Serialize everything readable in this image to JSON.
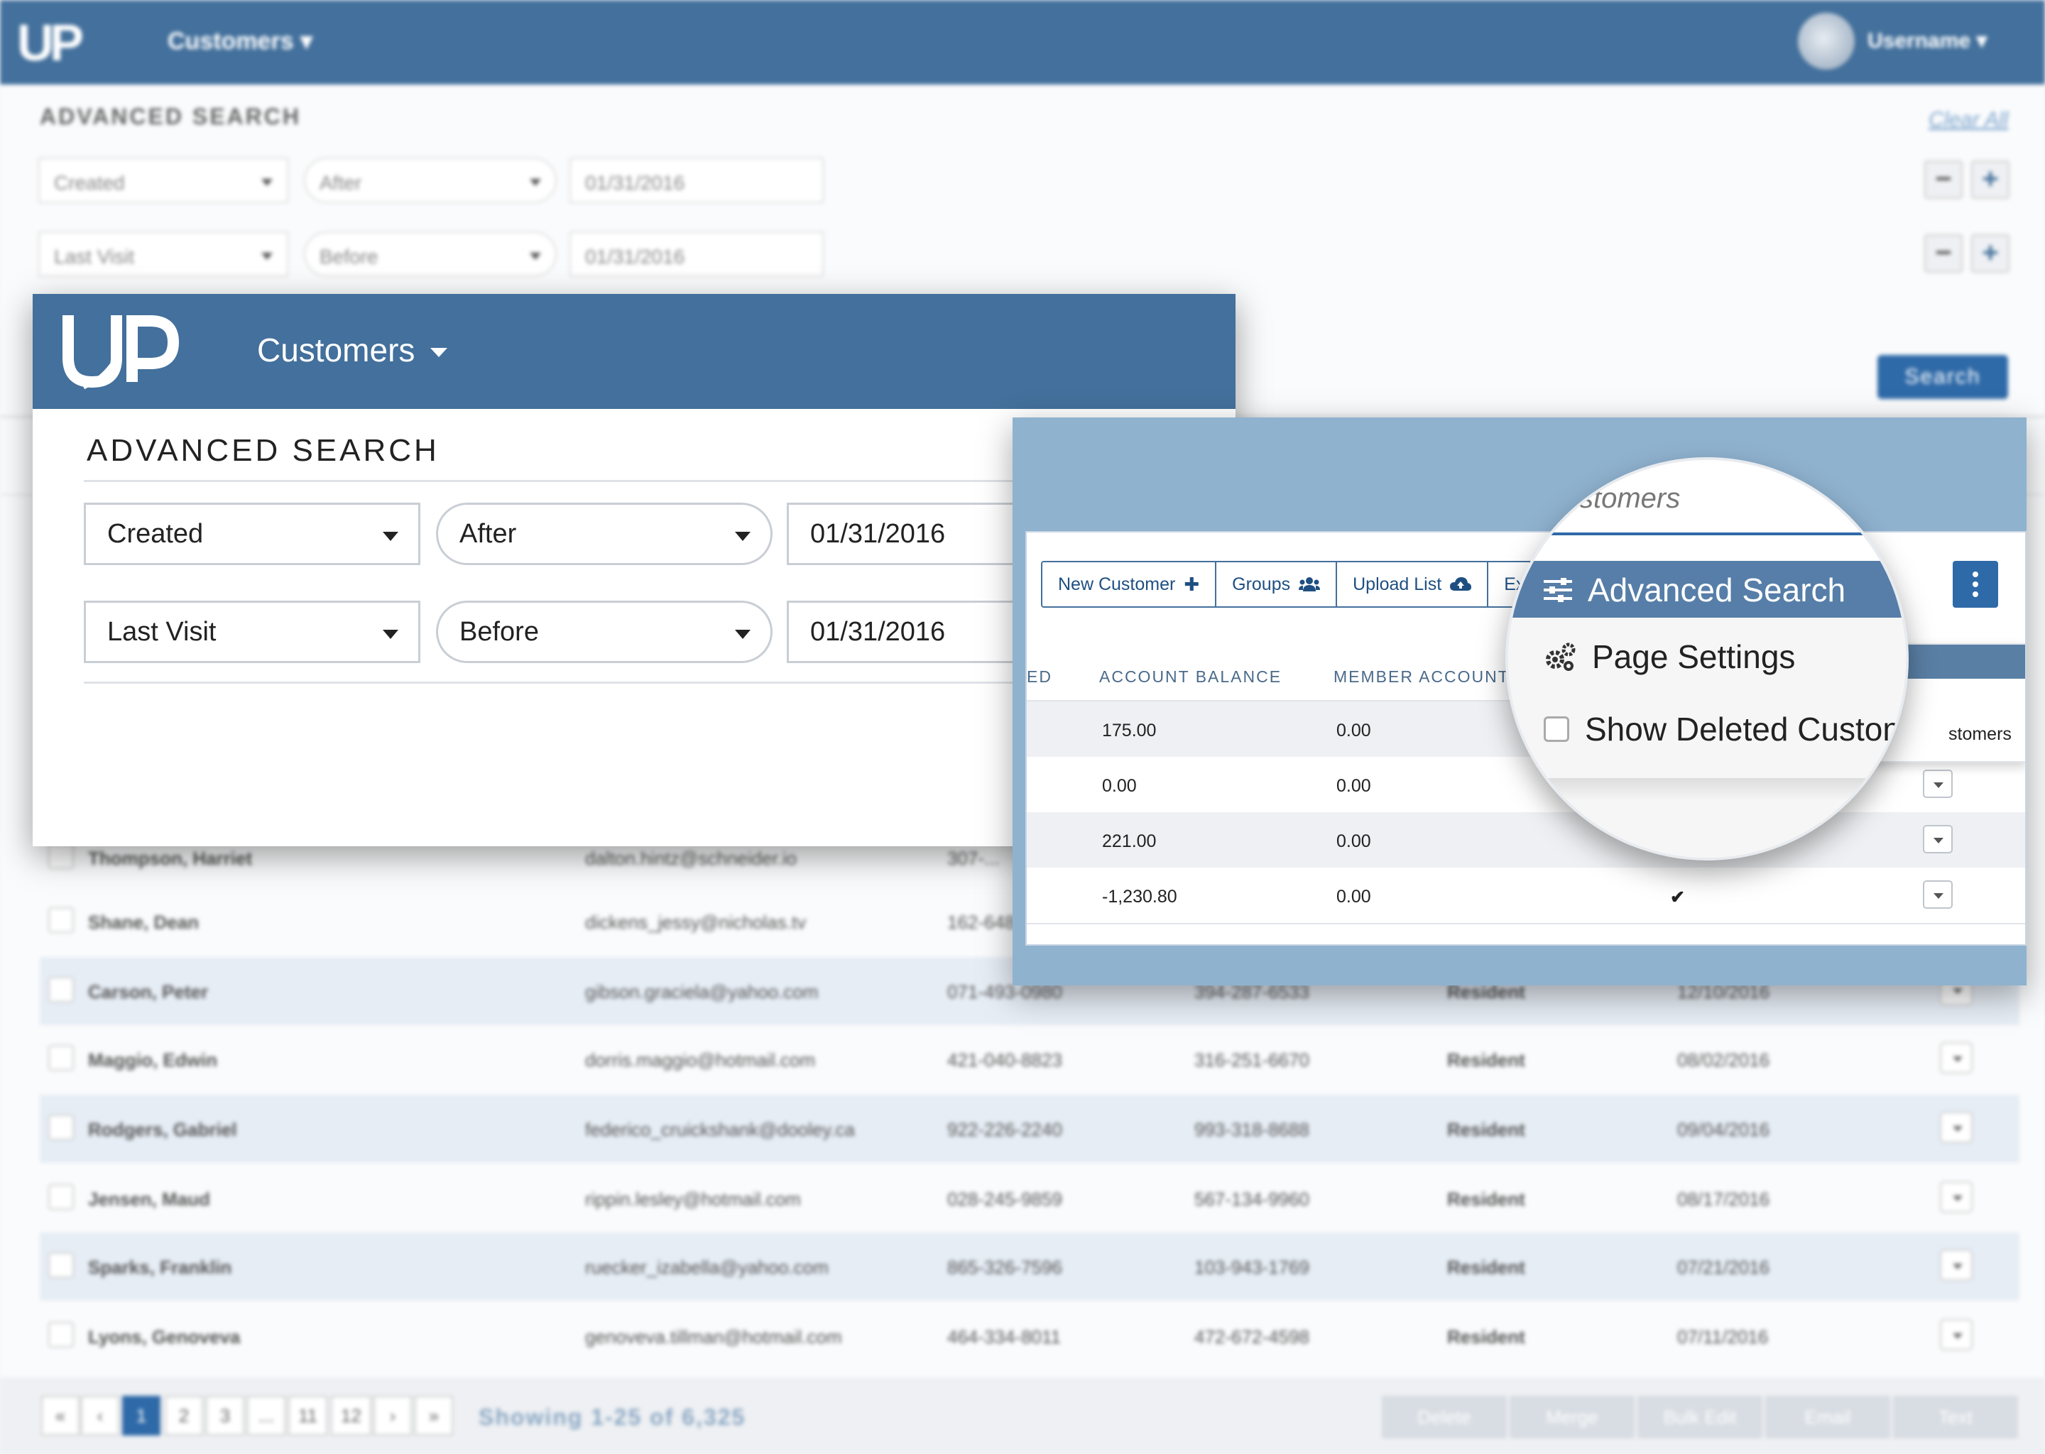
{
  "app": {
    "logo": "UP",
    "nav_label": "Customers",
    "username": "Username"
  },
  "colors": {
    "header": "#43709c",
    "primary": "#2f6aa8",
    "accent_bg": "#8fb2cf",
    "success": "#2e9e3e"
  },
  "advanced_search": {
    "title": "ADVANCED SEARCH",
    "clear_all": "Clear All",
    "search_label": "Search",
    "rows": [
      {
        "field": "Created",
        "operator": "After",
        "value": "01/31/2016"
      },
      {
        "field": "Last Visit",
        "operator": "Before",
        "value": "01/31/2016"
      }
    ]
  },
  "bg_table": {
    "rows": [
      {
        "name": "Thompson, Harriet",
        "email": "dalton.hintz@schneider.io",
        "phone1": "307-...",
        "phone2": "",
        "type": "",
        "date": ""
      },
      {
        "name": "Shane, Dean",
        "email": "dickens_jessy@nicholas.tv",
        "phone1": "162-648-...",
        "phone2": "",
        "type": "",
        "date": ""
      },
      {
        "name": "Carson, Peter",
        "email": "gibson.graciela@yahoo.com",
        "phone1": "071-493-0980",
        "phone2": "394-287-6533",
        "type": "Resident",
        "date": "12/10/2016"
      },
      {
        "name": "Maggio, Edwin",
        "email": "dorris.maggio@hotmail.com",
        "phone1": "421-040-8823",
        "phone2": "316-251-6670",
        "type": "Resident",
        "date": "08/02/2016"
      },
      {
        "name": "Rodgers, Gabriel",
        "email": "federico_cruickshank@dooley.ca",
        "phone1": "922-226-2240",
        "phone2": "993-318-8688",
        "type": "Resident",
        "date": "09/04/2016"
      },
      {
        "name": "Jensen, Maud",
        "email": "rippin.lesley@hotmail.com",
        "phone1": "028-245-9859",
        "phone2": "567-134-9960",
        "type": "Resident",
        "date": "08/17/2016"
      },
      {
        "name": "Sparks, Franklin",
        "email": "ruecker_izabella@yahoo.com",
        "phone1": "865-326-7596",
        "phone2": "103-943-1769",
        "type": "Resident",
        "date": "07/21/2016"
      },
      {
        "name": "Lyons, Genoveva",
        "email": "genoveva.tillman@hotmail.com",
        "phone1": "464-334-8011",
        "phone2": "472-672-4598",
        "type": "Resident",
        "date": "07/11/2016"
      }
    ]
  },
  "pagination": {
    "first": "«",
    "prev": "‹",
    "pages": [
      "1",
      "2",
      "3",
      "...",
      "11",
      "12"
    ],
    "next": "›",
    "last": "»",
    "showing": "Showing 1-25 of 6,325"
  },
  "bulk_actions": [
    "Delete",
    "Merge",
    "Bulk Edit",
    "Email",
    "Text"
  ],
  "customers_toolbar": {
    "new_customer": "New Customer",
    "groups": "Groups",
    "upload_list": "Upload List",
    "export_partial": "Ex",
    "search_partial": "stomers"
  },
  "customers_table": {
    "col_partial": "ED",
    "col_account_balance": "ACCOUNT BALANCE",
    "col_member_account": "MEMBER ACCOUNT",
    "rows": [
      {
        "account_balance": "175.00",
        "member_account": "0.00",
        "active": false
      },
      {
        "account_balance": "0.00",
        "member_account": "0.00",
        "active": false
      },
      {
        "account_balance": "221.00",
        "member_account": "0.00",
        "active": false
      },
      {
        "account_balance": "-1,230.80",
        "member_account": "0.00",
        "active": true
      }
    ]
  },
  "options_menu": {
    "advanced_search": "Advanced Search",
    "page_settings": "Page Settings",
    "show_deleted": "Show Deleted Custome",
    "show_deleted_tail": "stomers"
  },
  "icons": [
    "logo-icon",
    "caret-down-icon",
    "avatar",
    "plus-icon",
    "users-icon",
    "cloud-upload-icon",
    "kebab-icon",
    "sliders-icon",
    "gears-icon",
    "checkbox-icon",
    "check-icon",
    "minus-icon"
  ]
}
